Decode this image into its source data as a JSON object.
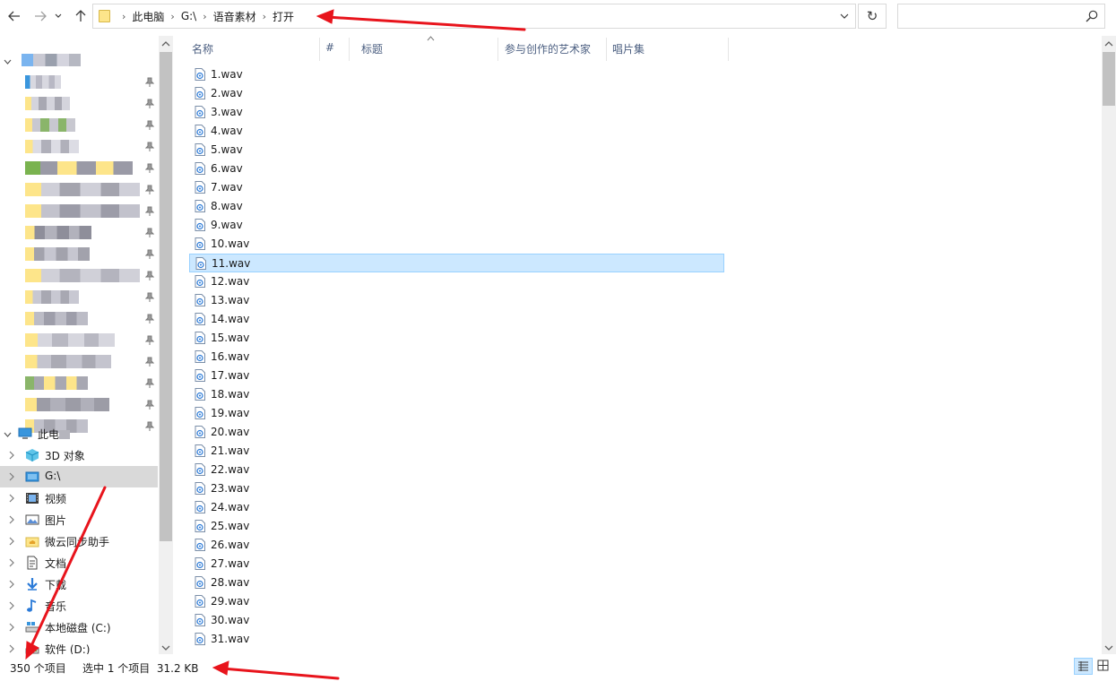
{
  "address": {
    "breadcrumbs": [
      "此电脑",
      "G:\\",
      "语音素材",
      "打开"
    ]
  },
  "search": {
    "placeholder": ""
  },
  "columns": {
    "name": "名称",
    "number": "#",
    "title": "标题",
    "artists": "参与创作的艺术家",
    "album": "唱片集"
  },
  "files": [
    "1.wav",
    "2.wav",
    "3.wav",
    "4.wav",
    "5.wav",
    "6.wav",
    "7.wav",
    "8.wav",
    "9.wav",
    "10.wav",
    "11.wav",
    "12.wav",
    "13.wav",
    "14.wav",
    "15.wav",
    "16.wav",
    "17.wav",
    "18.wav",
    "19.wav",
    "20.wav",
    "21.wav",
    "22.wav",
    "23.wav",
    "24.wav",
    "25.wav",
    "26.wav",
    "27.wav",
    "28.wav",
    "29.wav",
    "30.wav",
    "31.wav"
  ],
  "selected_file": "11.wav",
  "navpane": {
    "this_pc": "此电",
    "items": [
      {
        "label": "3D 对象",
        "icon": "cube-3d-icon"
      },
      {
        "label": "G:\\",
        "icon": "drive-icon"
      },
      {
        "label": "视频",
        "icon": "video-icon"
      },
      {
        "label": "图片",
        "icon": "picture-icon"
      },
      {
        "label": "微云同步助手",
        "icon": "cloud-folder-icon"
      },
      {
        "label": "文档",
        "icon": "document-icon"
      },
      {
        "label": "下载",
        "icon": "download-icon"
      },
      {
        "label": "音乐",
        "icon": "music-icon"
      },
      {
        "label": "本地磁盘 (C:)",
        "icon": "system-drive-icon"
      },
      {
        "label": "软件 (D:)",
        "icon": "disk-drive-icon"
      }
    ]
  },
  "status": {
    "item_count": "350 个项目",
    "selection": "选中 1 个项目  31.2 KB"
  },
  "colors": {
    "accent_blue": "#0078d7",
    "selection_bg": "#cce8ff",
    "selection_border": "#99d1ff",
    "annotation_red": "#e8141c",
    "folder_yellow": "#fde58a"
  }
}
